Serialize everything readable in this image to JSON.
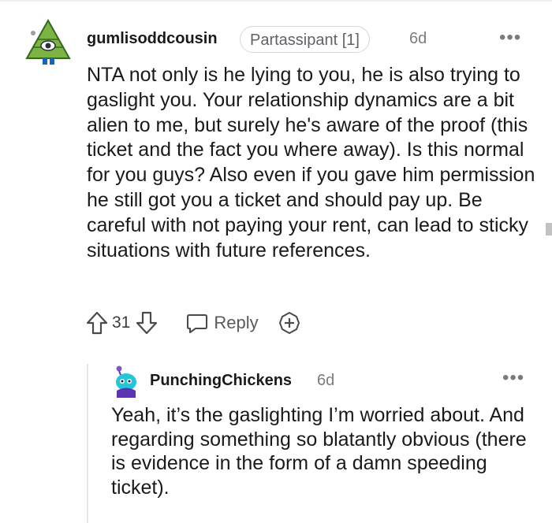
{
  "comment": {
    "author": "gumlisoddcousin",
    "flair": "Partassipant [1]",
    "time": "6d",
    "menu": "•••",
    "body": "NTA not only is he lying to you, he is also trying to gaslight you. Your relationship dynamics are a bit alien to me, but surely he's aware of the proof (this ticket and the fact you where away). Is this normal for you guys? Also even if you gave him permission he still got you a ticket and should pay up. Be careful with not paying your rent, can lead to sticky situations with future references.",
    "votes": "31",
    "reply_label": "Reply",
    "icons": {
      "upvote": "upvote-arrow-icon",
      "downvote": "downvote-arrow-icon",
      "reply": "speech-bubble-icon",
      "award": "plus-award-icon"
    },
    "accent": "#2e7d32"
  },
  "reply": {
    "author": "PunchingChickens",
    "time": "6d",
    "menu": "•••",
    "body": "Yeah, it’s the gaslighting I’m worried about. And regarding something so blatantly obvious (there is evidence in the form of a damn speeding ticket)."
  }
}
